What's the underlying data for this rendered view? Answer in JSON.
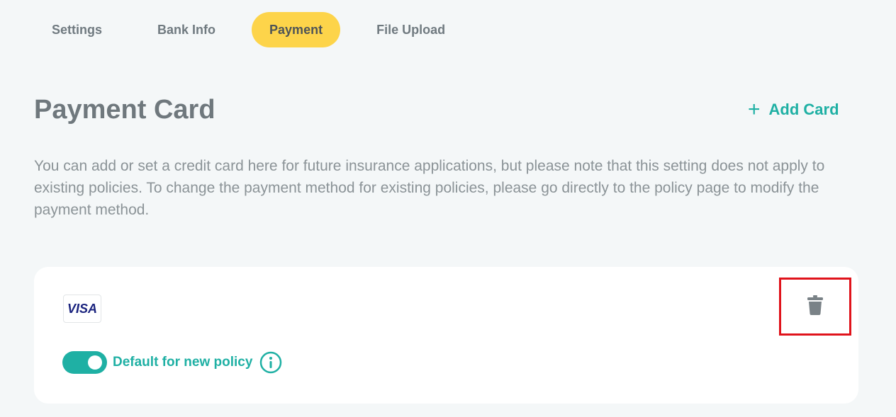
{
  "tabs": [
    {
      "label": "Settings",
      "active": false
    },
    {
      "label": "Bank Info",
      "active": false
    },
    {
      "label": "Payment",
      "active": true
    },
    {
      "label": "File Upload",
      "active": false
    }
  ],
  "header": {
    "title": "Payment Card",
    "add_card_label": "Add Card",
    "add_card_icon": "plus-icon"
  },
  "description": "You can add or set a credit card here for future insurance applications, but please note that this setting does not apply to existing policies. To change the payment method for existing policies, please go directly to the policy page to modify the payment method.",
  "card": {
    "brand": "VISA",
    "delete_icon": "trash-icon",
    "default_toggle": {
      "on": true,
      "label": "Default for new policy",
      "info_icon": "info-icon"
    }
  },
  "colors": {
    "accent": "#1fb0a4",
    "active_tab": "#fdd44a",
    "highlight_border": "#e0131b",
    "background": "#f4f7f8"
  }
}
